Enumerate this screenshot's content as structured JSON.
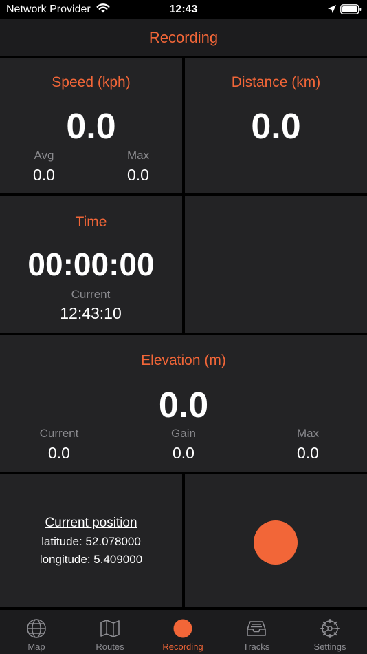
{
  "status_bar": {
    "carrier": "Network Provider",
    "time": "12:43"
  },
  "nav": {
    "title": "Recording"
  },
  "speed": {
    "title": "Speed (kph)",
    "value": "0.0",
    "avg_label": "Avg",
    "avg_value": "0.0",
    "max_label": "Max",
    "max_value": "0.0"
  },
  "distance": {
    "title": "Distance (km)",
    "value": "0.0"
  },
  "time": {
    "title": "Time",
    "value": "00:00:00",
    "current_label": "Current",
    "current_value": "12:43:10"
  },
  "elevation": {
    "title": "Elevation (m)",
    "value": "0.0",
    "current_label": "Current",
    "current_value": "0.0",
    "gain_label": "Gain",
    "gain_value": "0.0",
    "max_label": "Max",
    "max_value": "0.0"
  },
  "position": {
    "title": "Current position",
    "latitude": "latitude: 52.078000",
    "longitude": "longitude: 5.409000"
  },
  "tabs": [
    {
      "label": "Map",
      "icon": "globe-icon",
      "active": false
    },
    {
      "label": "Routes",
      "icon": "map-icon",
      "active": false
    },
    {
      "label": "Recording",
      "icon": "record-icon",
      "active": true
    },
    {
      "label": "Tracks",
      "icon": "tray-icon",
      "active": false
    },
    {
      "label": "Settings",
      "icon": "gear-icon",
      "active": false
    }
  ],
  "colors": {
    "accent": "#f26638",
    "panel": "#232325",
    "background": "#000000",
    "muted": "#8a8a8e"
  }
}
